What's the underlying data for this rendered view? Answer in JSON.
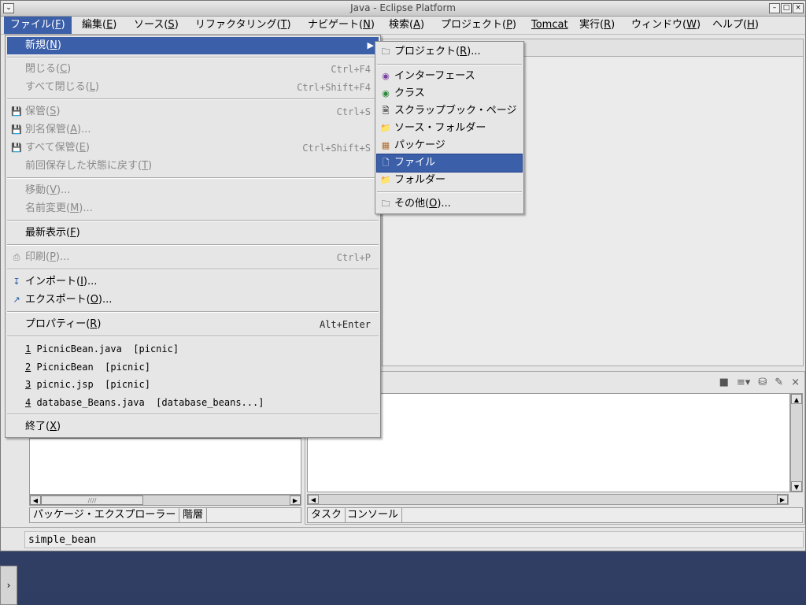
{
  "window": {
    "title": "Java - Eclipse Platform"
  },
  "menubar": {
    "items": [
      {
        "label": "ファイル(",
        "mn": "F",
        "end": ")"
      },
      {
        "label": "編集(",
        "mn": "E",
        "end": ")"
      },
      {
        "label": "ソース(",
        "mn": "S",
        "end": ")"
      },
      {
        "label": "リファクタリング(",
        "mn": "T",
        "end": ")"
      },
      {
        "label": "ナビゲート(",
        "mn": "N",
        "end": ")"
      },
      {
        "label": "検索(",
        "mn": "A",
        "end": ")"
      },
      {
        "label": "プロジェクト(",
        "mn": "P",
        "end": ")"
      },
      {
        "label": "Tomcat",
        "mn": "",
        "end": ""
      },
      {
        "label": "実行(",
        "mn": "R",
        "end": ")"
      },
      {
        "label": "ウィンドウ(",
        "mn": "W",
        "end": ")"
      },
      {
        "label": "ヘルプ(",
        "mn": "H",
        "end": ")"
      }
    ]
  },
  "file_menu": {
    "new": {
      "label": "新規(",
      "mn": "N",
      "end": ")"
    },
    "close": {
      "label": "閉じる(",
      "mn": "C",
      "end": ")",
      "accel": "Ctrl+F4"
    },
    "close_all": {
      "label": "すべて閉じる(",
      "mn": "L",
      "end": ")",
      "accel": "Ctrl+Shift+F4"
    },
    "save": {
      "label": "保管(",
      "mn": "S",
      "end": ")",
      "accel": "Ctrl+S"
    },
    "save_as": {
      "label": "別名保管(",
      "mn": "A",
      "end": ")..."
    },
    "save_all": {
      "label": "すべて保管(",
      "mn": "E",
      "end": ")",
      "accel": "Ctrl+Shift+S"
    },
    "revert": {
      "label": "前回保存した状態に戻す(",
      "mn": "T",
      "end": ")"
    },
    "move": {
      "label": "移動(",
      "mn": "V",
      "end": ")..."
    },
    "rename": {
      "label": "名前変更(",
      "mn": "M",
      "end": ")..."
    },
    "refresh": {
      "label": "最新表示(",
      "mn": "F",
      "end": ")"
    },
    "print": {
      "label": "印刷(",
      "mn": "P",
      "end": ")...",
      "accel": "Ctrl+P"
    },
    "import": {
      "label": "インポート(",
      "mn": "I",
      "end": ")..."
    },
    "export": {
      "label": "エクスポート(",
      "mn": "O",
      "end": ")..."
    },
    "properties": {
      "label": "プロパティー(",
      "mn": "R",
      "end": ")",
      "accel": "Alt+Enter"
    },
    "recent": [
      {
        "num": "1",
        "text": " PicnicBean.java  [picnic]"
      },
      {
        "num": "2",
        "text": " PicnicBean  [picnic]"
      },
      {
        "num": "3",
        "text": " picnic.jsp  [picnic]"
      },
      {
        "num": "4",
        "text": " database_Beans.java  [database_beans...]"
      }
    ],
    "exit": {
      "label": "終了(",
      "mn": "X",
      "end": ")"
    }
  },
  "new_submenu": {
    "project": {
      "label": "プロジェクト(",
      "mn": "R",
      "end": ")..."
    },
    "interface": "インターフェース",
    "class": "クラス",
    "scrapbook": "スクラップブック・ページ",
    "source_folder": "ソース・フォルダー",
    "package": "パッケージ",
    "file": "ファイル",
    "folder": "フォルダー",
    "other": {
      "label": "その他(",
      "mn": "O",
      "end": ")..."
    }
  },
  "views": {
    "left_tabs": [
      "パッケージ・エクスプローラー",
      "階層"
    ],
    "right_tabs": [
      "タスク",
      "コンソール"
    ]
  },
  "status": {
    "text": "simple_bean"
  },
  "icons": {
    "accent": "#3b5fa9"
  }
}
